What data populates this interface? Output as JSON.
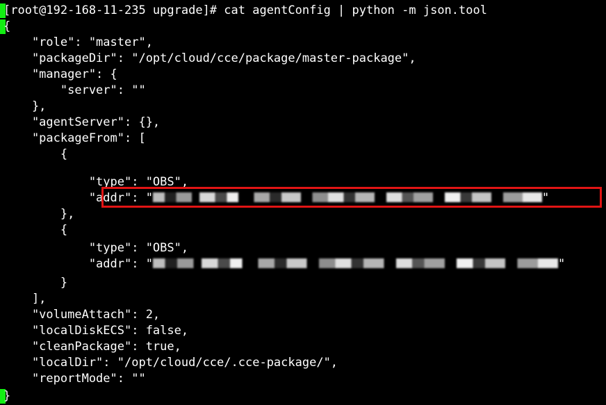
{
  "terminal": {
    "prompt": "[root@192-168-11-235 upgrade]# ",
    "command": "cat agentConfig | python -m json.tool",
    "lines": [
      "{",
      "    \"role\": \"master\",",
      "    \"packageDir\": \"/opt/cloud/cce/package/master-package\",",
      "    \"manager\": {",
      "        \"server\": \"\"",
      "    },",
      "    \"agentServer\": {},",
      "    \"packageFrom\": [",
      "        {",
      "            \"type\": \"OBS\",",
      "            \"addr\": \"",
      "        },",
      "        {",
      "            \"type\": \"OBS\",",
      "            \"addr\": \"",
      "        }",
      "    ],",
      "    \"volumeAttach\": 2,",
      "    \"localDiskECS\": false,",
      "    \"cleanPackage\": true,",
      "    \"localDir\": \"/opt/cloud/cce/.cce-package/\",",
      "    \"reportMode\": \"\"",
      "}"
    ],
    "addr_line_end": "\"",
    "colors": {
      "background": "#000000",
      "text": "#ffffff",
      "cursor": "#13ee13",
      "highlight": "#e11414"
    }
  }
}
